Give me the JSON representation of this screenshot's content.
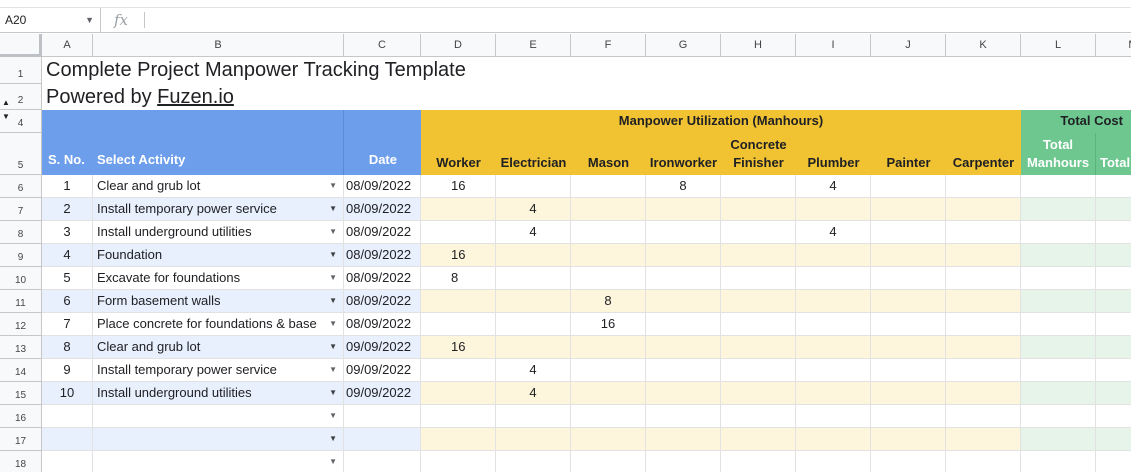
{
  "formula_bar": {
    "cell_ref": "A20",
    "fx_symbol": "fx",
    "value": ""
  },
  "columns": [
    "A",
    "B",
    "C",
    "D",
    "E",
    "F",
    "G",
    "H",
    "I",
    "J",
    "K",
    "L",
    "M"
  ],
  "row_numbers": [
    "1",
    "2",
    "4",
    "5",
    "6",
    "7",
    "8",
    "9",
    "10",
    "11",
    "12",
    "13",
    "14",
    "15",
    "16",
    "17",
    "18"
  ],
  "title": "Complete Project Manpower Tracking Template",
  "subtitle_prefix": "Powered by ",
  "subtitle_link": "Fuzen.io",
  "group_headers": {
    "manpower": "Manpower Utilization (Manhours)",
    "total_cost": "Total Cost"
  },
  "headers": {
    "sno": "S. No.",
    "activity": "Select Activity",
    "date": "Date",
    "worker": "Worker",
    "electrician": "Electrician",
    "mason": "Mason",
    "ironworker": "Ironworker",
    "concrete_1": "Concrete",
    "concrete_2": "Finisher",
    "plumber": "Plumber",
    "painter": "Painter",
    "carpenter": "Carpenter",
    "total_1": "Total",
    "total_2": "Manhours",
    "total_m": "Total"
  },
  "rows": [
    {
      "sno": "1",
      "activity": "Clear and grub lot",
      "date": "08/09/2022",
      "worker": "16",
      "electrician": "",
      "mason": "",
      "ironworker": "8",
      "concrete": "",
      "plumber": "4",
      "painter": "",
      "carpenter": ""
    },
    {
      "sno": "2",
      "activity": "Install temporary power service",
      "date": "08/09/2022",
      "worker": "",
      "electrician": "4",
      "mason": "",
      "ironworker": "",
      "concrete": "",
      "plumber": "",
      "painter": "",
      "carpenter": ""
    },
    {
      "sno": "3",
      "activity": "Install underground utilities",
      "date": "08/09/2022",
      "worker": "",
      "electrician": "4",
      "mason": "",
      "ironworker": "",
      "concrete": "",
      "plumber": "4",
      "painter": "",
      "carpenter": ""
    },
    {
      "sno": "4",
      "activity": "Foundation",
      "date": "08/09/2022",
      "worker": "16",
      "electrician": "",
      "mason": "",
      "ironworker": "",
      "concrete": "",
      "plumber": "",
      "painter": "",
      "carpenter": ""
    },
    {
      "sno": "5",
      "activity": "Excavate for foundations",
      "date": "08/09/2022",
      "worker": "8",
      "electrician": "",
      "mason": "",
      "ironworker": "",
      "concrete": "",
      "plumber": "",
      "painter": "",
      "carpenter": ""
    },
    {
      "sno": "6",
      "activity": "Form basement walls",
      "date": "08/09/2022",
      "worker": "",
      "electrician": "",
      "mason": "8",
      "ironworker": "",
      "concrete": "",
      "plumber": "",
      "painter": "",
      "carpenter": ""
    },
    {
      "sno": "7",
      "activity": "Place concrete for foundations & base",
      "date": "08/09/2022",
      "worker": "",
      "electrician": "",
      "mason": "16",
      "ironworker": "",
      "concrete": "",
      "plumber": "",
      "painter": "",
      "carpenter": ""
    },
    {
      "sno": "8",
      "activity": "Clear and grub lot",
      "date": "09/09/2022",
      "worker": "16",
      "electrician": "",
      "mason": "",
      "ironworker": "",
      "concrete": "",
      "plumber": "",
      "painter": "",
      "carpenter": ""
    },
    {
      "sno": "9",
      "activity": "Install temporary power service",
      "date": "09/09/2022",
      "worker": "",
      "electrician": "4",
      "mason": "",
      "ironworker": "",
      "concrete": "",
      "plumber": "",
      "painter": "",
      "carpenter": ""
    },
    {
      "sno": "10",
      "activity": "Install underground utilities",
      "date": "09/09/2022",
      "worker": "",
      "electrician": "4",
      "mason": "",
      "ironworker": "",
      "concrete": "",
      "plumber": "",
      "painter": "",
      "carpenter": ""
    },
    {
      "sno": "",
      "activity": "",
      "date": "",
      "worker": "",
      "electrician": "",
      "mason": "",
      "ironworker": "",
      "concrete": "",
      "plumber": "",
      "painter": "",
      "carpenter": ""
    },
    {
      "sno": "",
      "activity": "",
      "date": "",
      "worker": "",
      "electrician": "",
      "mason": "",
      "ironworker": "",
      "concrete": "",
      "plumber": "",
      "painter": "",
      "carpenter": ""
    },
    {
      "sno": "",
      "activity": "",
      "date": "",
      "worker": "",
      "electrician": "",
      "mason": "",
      "ironworker": "",
      "concrete": "",
      "plumber": "",
      "painter": "",
      "carpenter": ""
    }
  ],
  "colors": {
    "header_blue": "#6d9eeb",
    "header_gold": "#f1c232",
    "header_green": "#6dc78f",
    "band_blue": "#e8f0fe",
    "band_gold": "#fdf6dc",
    "band_green": "#e6f4ea"
  }
}
